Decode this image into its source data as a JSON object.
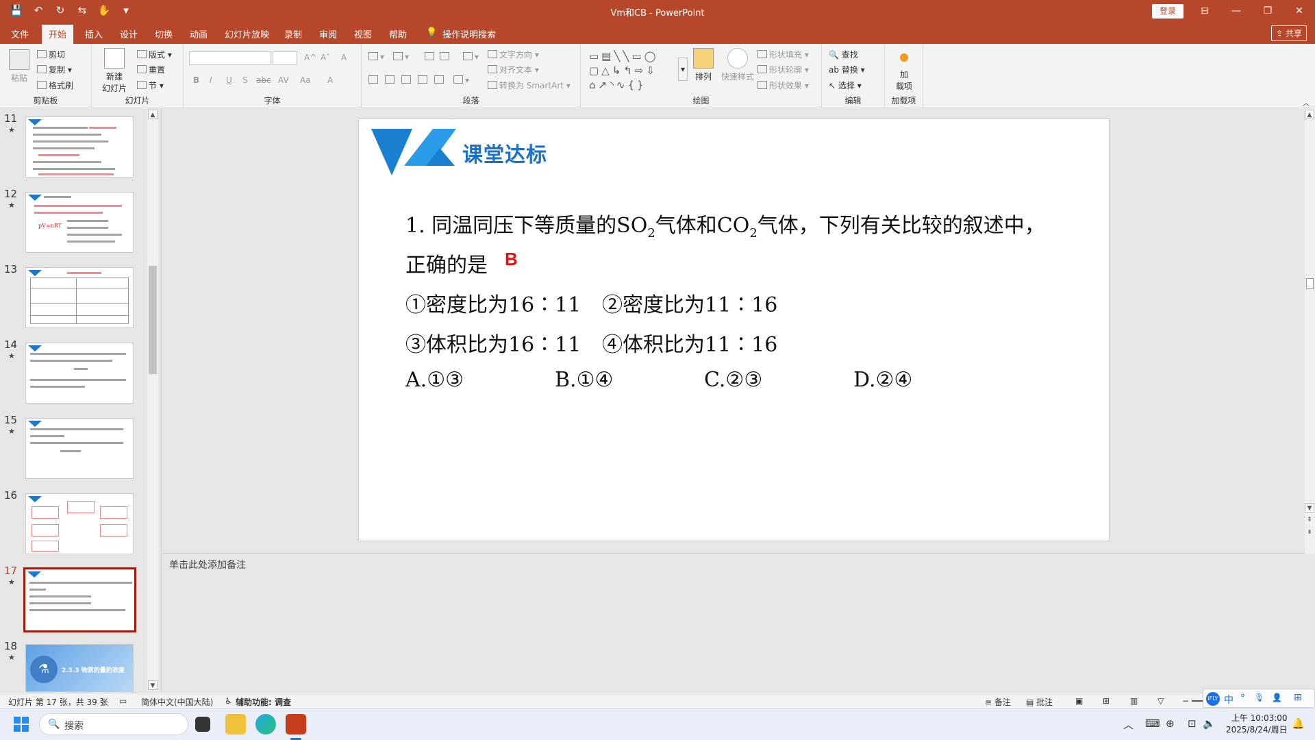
{
  "window": {
    "title": "Vm和CB  -  PowerPoint",
    "login": "登录",
    "controls": [
      "⊟",
      "—",
      "❐",
      "✕"
    ],
    "quick_access": [
      "💾",
      "↶",
      "↻",
      "⇆",
      "✋",
      "▾"
    ]
  },
  "menu": {
    "items": [
      "文件",
      "开始",
      "插入",
      "设计",
      "切换",
      "动画",
      "幻灯片放映",
      "录制",
      "审阅",
      "视图",
      "帮助"
    ],
    "active": "开始",
    "search": "操作说明搜索",
    "share": "共享"
  },
  "ribbon": {
    "clipboard": {
      "paste": "粘贴",
      "cut": "剪切",
      "copy": "复制",
      "painter": "格式刷",
      "label": "剪贴板"
    },
    "slides": {
      "new": "新建",
      "new2": "幻灯片",
      "layout": "版式",
      "reset": "重置",
      "section": "节",
      "label": "幻灯片"
    },
    "font": {
      "label": "字体",
      "bold": "B",
      "italic": "I",
      "underline": "U",
      "shadow": "S",
      "strike": "abc",
      "spacing": "AV",
      "case": "Aa",
      "color": "A",
      "grow": "A^",
      "shrink": "Aˇ",
      "clear": "A"
    },
    "paragraph": {
      "label": "段落",
      "text_dir": "文字方向",
      "align_text": "对齐文本",
      "smartart": "转换为 SmartArt"
    },
    "drawing": {
      "label": "绘图",
      "arrange": "排列",
      "quick_styles": "快速样式",
      "fill": "形状填充",
      "outline": "形状轮廓",
      "effects": "形状效果"
    },
    "editing": {
      "label": "编辑",
      "find": "查找",
      "replace": "替换",
      "select": "选择"
    },
    "addins": {
      "label": "加载项",
      "btn1": "加",
      "btn2": "载项"
    }
  },
  "thumbnails": [
    {
      "num": "11",
      "star": "★"
    },
    {
      "num": "12",
      "star": "★"
    },
    {
      "num": "13",
      "star": "★"
    },
    {
      "num": "14",
      "star": "★"
    },
    {
      "num": "15",
      "star": "★"
    },
    {
      "num": "16",
      "star": ""
    },
    {
      "num": "17",
      "star": "★"
    },
    {
      "num": "18",
      "star": "★"
    }
  ],
  "thumb_texts": {
    "t12": "pV=nRT",
    "t18": "2.3.3 物质的量的浓度"
  },
  "slide": {
    "title": "课堂达标",
    "q_line1_a": "1. 同温同压下等质量的SO",
    "q_sub1": "2",
    "q_line1_b": "气体和CO",
    "q_sub2": "2",
    "q_line1_c": "气体，下列有关比较的叙述中，",
    "q_line2": "正确的是",
    "answer": "B",
    "opt1": "①密度比为16∶11",
    "opt2": "②密度比为11∶16",
    "opt3": "③体积比为16∶11",
    "opt4": "④体积比为11∶16",
    "choice_a": "A.①③",
    "choice_b": "B.①④",
    "choice_c": "C.②③",
    "choice_d": "D.②④",
    "logo_colors": [
      "#1a7fd0",
      "#2a9be8"
    ]
  },
  "notes": {
    "placeholder": "单击此处添加备注"
  },
  "status": {
    "slide_info": "幻灯片 第 17 张，共 39 张",
    "language": "简体中文(中国大陆)",
    "accessibility": "辅助功能: 调查",
    "notes_btn": "备注",
    "comments_btn": "批注"
  },
  "taskbar": {
    "search": "搜索",
    "time": "上午 10:03:00",
    "date": "2025/8/24/周日",
    "ime": [
      "中",
      "°",
      "🎙",
      "👤",
      "⊞"
    ]
  }
}
